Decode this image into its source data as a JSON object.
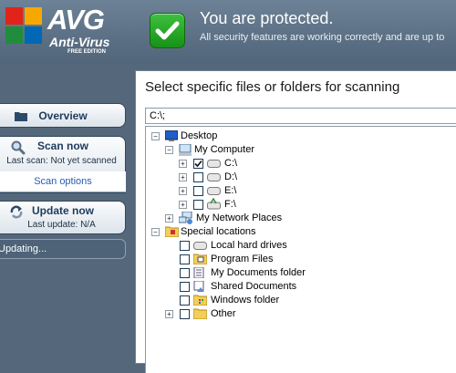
{
  "header": {
    "brand": "AVG",
    "product": "Anti-Virus",
    "edition": "FREE EDITION",
    "status_title": "You are protected.",
    "status_subtitle": "All security features are working correctly and are up to"
  },
  "nav": {
    "overview": "Overview",
    "scan_now": "Scan now",
    "last_scan": "Last scan: Not yet scanned",
    "scan_options": "Scan options",
    "update_now": "Update now",
    "last_update": "Last update: N/A",
    "updating": "Updating..."
  },
  "panel": {
    "title": "Select specific files or folders for scanning",
    "path_value": "C:\\;"
  },
  "tree": {
    "desktop": "Desktop",
    "my_computer": "My Computer",
    "drive_c": "C:\\",
    "drive_d": "D:\\",
    "drive_e": "E:\\",
    "drive_f": "F:\\",
    "network": "My Network Places",
    "special": "Special locations",
    "local_drives": "Local hard drives",
    "program_files": "Program Files",
    "my_documents": "My Documents folder",
    "shared_documents": "Shared Documents",
    "windows_folder": "Windows folder",
    "other": "Other"
  },
  "colors": {
    "header_bg": "#596d82",
    "protected_green": "#1ea51e",
    "link_blue": "#2a5bb0"
  }
}
